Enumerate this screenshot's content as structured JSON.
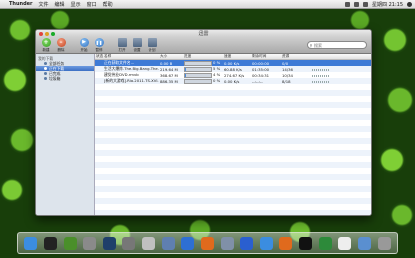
{
  "menubar": {
    "app_name": "Thunder",
    "items": [
      "文件",
      "编辑",
      "显示",
      "窗口",
      "帮助"
    ],
    "clock": "星期四 21:15"
  },
  "window": {
    "title": "迅雷"
  },
  "toolbar": {
    "buttons": [
      {
        "label": "新建",
        "icon": "plus-icon"
      },
      {
        "label": "删除",
        "icon": "minus-icon"
      },
      {
        "label": "开始",
        "icon": "play-icon"
      },
      {
        "label": "暂停",
        "icon": "pause-icon"
      },
      {
        "label": "打开",
        "icon": "folder-icon"
      },
      {
        "label": "设置",
        "icon": "gear-icon"
      },
      {
        "label": "计划",
        "icon": "schedule-icon"
      }
    ],
    "search_placeholder": "搜索"
  },
  "sidebar": {
    "group": "我的下载",
    "items": [
      {
        "label": "全部任务",
        "selected": false
      },
      {
        "label": "正在下载",
        "selected": true
      },
      {
        "label": "已完成",
        "selected": false
      },
      {
        "label": "垃圾箱",
        "selected": false
      }
    ]
  },
  "table": {
    "headers": [
      "状态",
      "名称",
      "大小",
      "进度",
      "速度",
      "剩余时间",
      "资源"
    ],
    "rows": [
      {
        "name": "正在获取文件名...",
        "size": "0.00 B",
        "progress": 0,
        "progress_text": "0 %",
        "speed": "0.00 K/s",
        "time": "00:00:00",
        "peers": "0/0",
        "selected": true
      },
      {
        "name": "生活大爆炸.The.Big.Bang.The...",
        "size": "219.64 M",
        "progress": 5,
        "progress_text": "5 %",
        "speed": "60.88 K/s",
        "time": "01:35:00",
        "peers": "14/36",
        "selected": false
      },
      {
        "name": "建党伟业DVD.rmvb",
        "size": "368.67 M",
        "progress": 4,
        "progress_text": "4 %",
        "speed": "274.67 K/s",
        "time": "00:34:31",
        "peers": "10/34",
        "selected": false
      },
      {
        "name": "[新的大游戏].Rio.2011.TS.XVI...",
        "size": "886.35 M",
        "progress": 0,
        "progress_text": "0 %",
        "speed": "0.00 K/s",
        "time": "--:--:--",
        "peers": "8/18",
        "selected": false
      }
    ]
  },
  "dock": {
    "icons": [
      "finder-icon",
      "qq-icon",
      "chrome-icon",
      "tools-icon",
      "dashboard-icon",
      "system-preferences-icon",
      "launchpad-icon",
      "mail-icon",
      "safari-icon",
      "firefox-icon",
      "drive-icon",
      "thunder-icon",
      "chrome-icon",
      "firefox-icon",
      "terminal-icon",
      "activity-monitor-icon",
      "document-icon",
      "preview-icon",
      "trash-icon"
    ]
  }
}
